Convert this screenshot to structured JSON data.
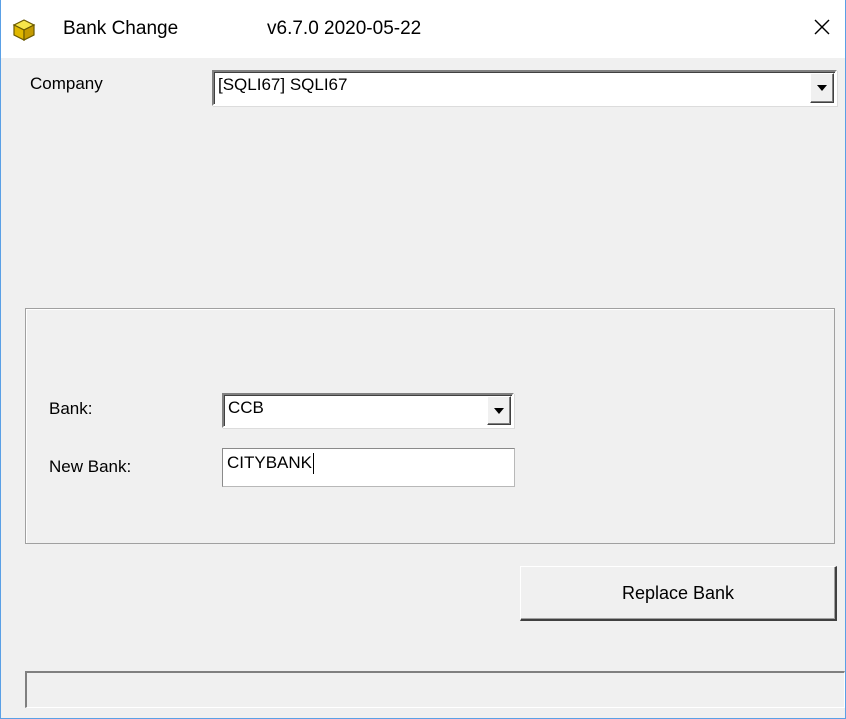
{
  "window": {
    "title": "Bank Change",
    "version": "v6.7.0  2020-05-22",
    "icon": "yellow-cube-icon",
    "close_icon": "close-icon"
  },
  "company": {
    "label": "Company",
    "selected": "[SQLI67] SQLI67"
  },
  "bank": {
    "label": "Bank:",
    "selected": "CCB"
  },
  "new_bank": {
    "label": "New Bank:",
    "value": "CITYBANK"
  },
  "actions": {
    "replace_label": "Replace Bank"
  },
  "status": {
    "text": ""
  },
  "colors": {
    "accent": "#5aa0e6",
    "face": "#f0f0f0"
  }
}
